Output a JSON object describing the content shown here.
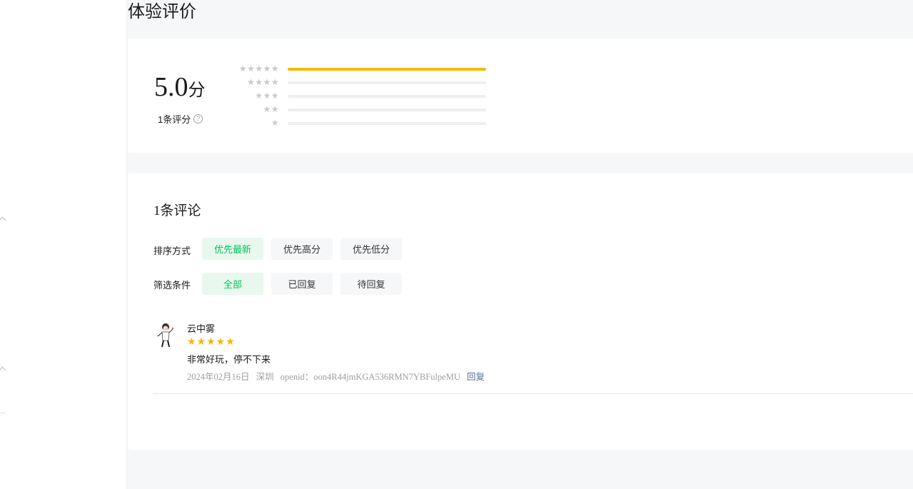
{
  "page": {
    "title": "体验评价"
  },
  "summary": {
    "score": "5.0",
    "score_unit": "分",
    "count_label": "1条评分",
    "help_glyph": "?",
    "distribution": [
      {
        "stars": 5,
        "star_glyphs": "★★★★★",
        "fraction": 1.0
      },
      {
        "stars": 4,
        "star_glyphs": "★★★★",
        "fraction": 0.0
      },
      {
        "stars": 3,
        "star_glyphs": "★★★",
        "fraction": 0.0
      },
      {
        "stars": 2,
        "star_glyphs": "★★",
        "fraction": 0.0
      },
      {
        "stars": 1,
        "star_glyphs": "★",
        "fraction": 0.0
      }
    ],
    "bar_color": "#f5b800"
  },
  "reviews": {
    "title": "1条评论",
    "sort": {
      "label": "排序方式",
      "options": [
        "优先最新",
        "优先高分",
        "优先低分"
      ],
      "selected": "优先最新"
    },
    "filter": {
      "label": "筛选条件",
      "options": [
        "全部",
        "已回复",
        "待回复"
      ],
      "selected": "全部"
    },
    "items": [
      {
        "name": "云中雾",
        "rating": 5,
        "stars": "★★★★★",
        "text": "非常好玩，停不下来",
        "date": "2024年02月16日",
        "location": "深圳",
        "openid": "openid：oon4R44jmKGA536RMN7YBFulpeMU",
        "reply_label": "回复"
      }
    ]
  },
  "colors": {
    "accent": "#07c160",
    "star": "#f5b800",
    "link": "#576b95"
  }
}
